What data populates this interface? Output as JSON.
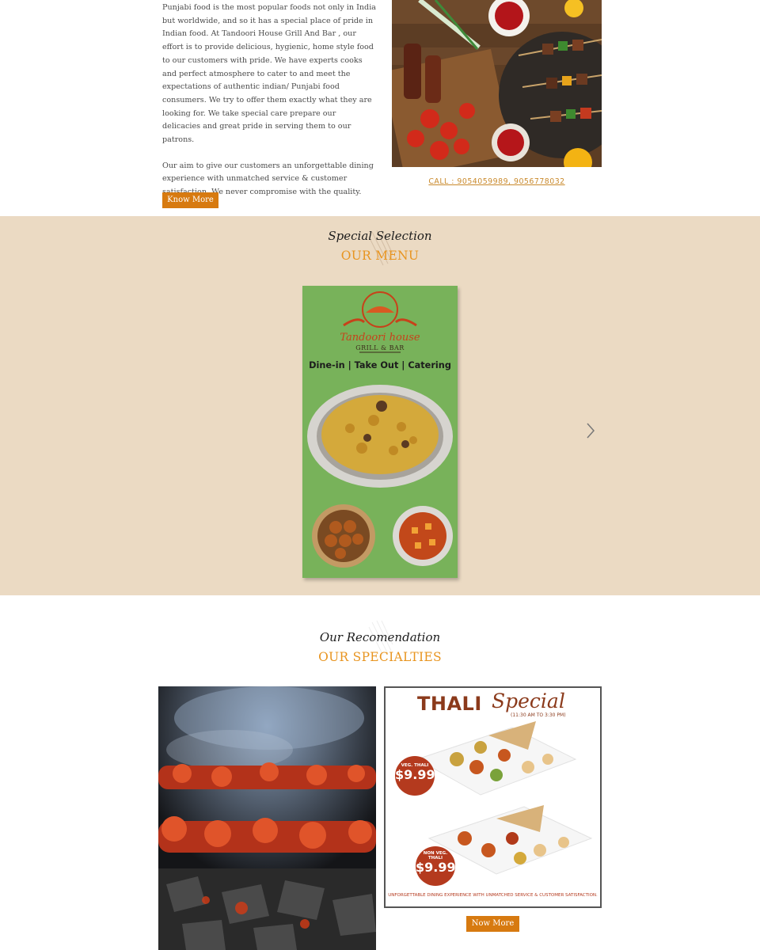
{
  "about": {
    "paragraph1": "Punjabi food is the most popular foods not only in India but worldwide, and so it has a special place of pride in Indian food. At Tandoori House Grill And Bar , our effort is to provide delicious, hygienic, home style food to our customers with pride. We have experts cooks and perfect atmosphere to cater to and meet the expectations of authentic indian/ Punjabi food consumers. We try to offer them exactly what they are looking for. We take special care prepare our delicacies and great pride in serving them to our patrons.",
    "paragraph2": "Our aim to give our customers an unforgettable dining experience with unmatched service & customer satisfaction. We never compromise with the quality.",
    "button_label": "Know More",
    "call_text": "CALL : 9054059989, 9056778032"
  },
  "menu_section": {
    "script_heading": "Special Selection",
    "heading": "OUR MENU",
    "card": {
      "brand": "Tandoori house",
      "brand_sub": "GRILL & BAR",
      "tagline": "Dine-in | Take Out | Catering"
    }
  },
  "specialties_section": {
    "script_heading": "Our Recomendation",
    "heading": "OUR SPECIALTIES",
    "thali": {
      "title": "THALI",
      "title_script": "Special",
      "time": "(11:30 AM TO 3:30 PM)",
      "veg_label": "VEG. THALI",
      "veg_price": "$9.99",
      "nonveg_label": "NON VEG. THALI",
      "nonveg_price": "$9.99",
      "footer": "UNFORGETTABLE DINING EXPERIENCE WITH UNMATCHED SERVICE & CUSTOMER SATISFACTION."
    },
    "button_label": "Now More"
  },
  "colors": {
    "accent_orange": "#d77a10",
    "heading_orange": "#e8941f",
    "menu_bg": "#ebdac3",
    "menu_card_green": "#78b25a",
    "thali_brown": "#8b3a1b"
  }
}
